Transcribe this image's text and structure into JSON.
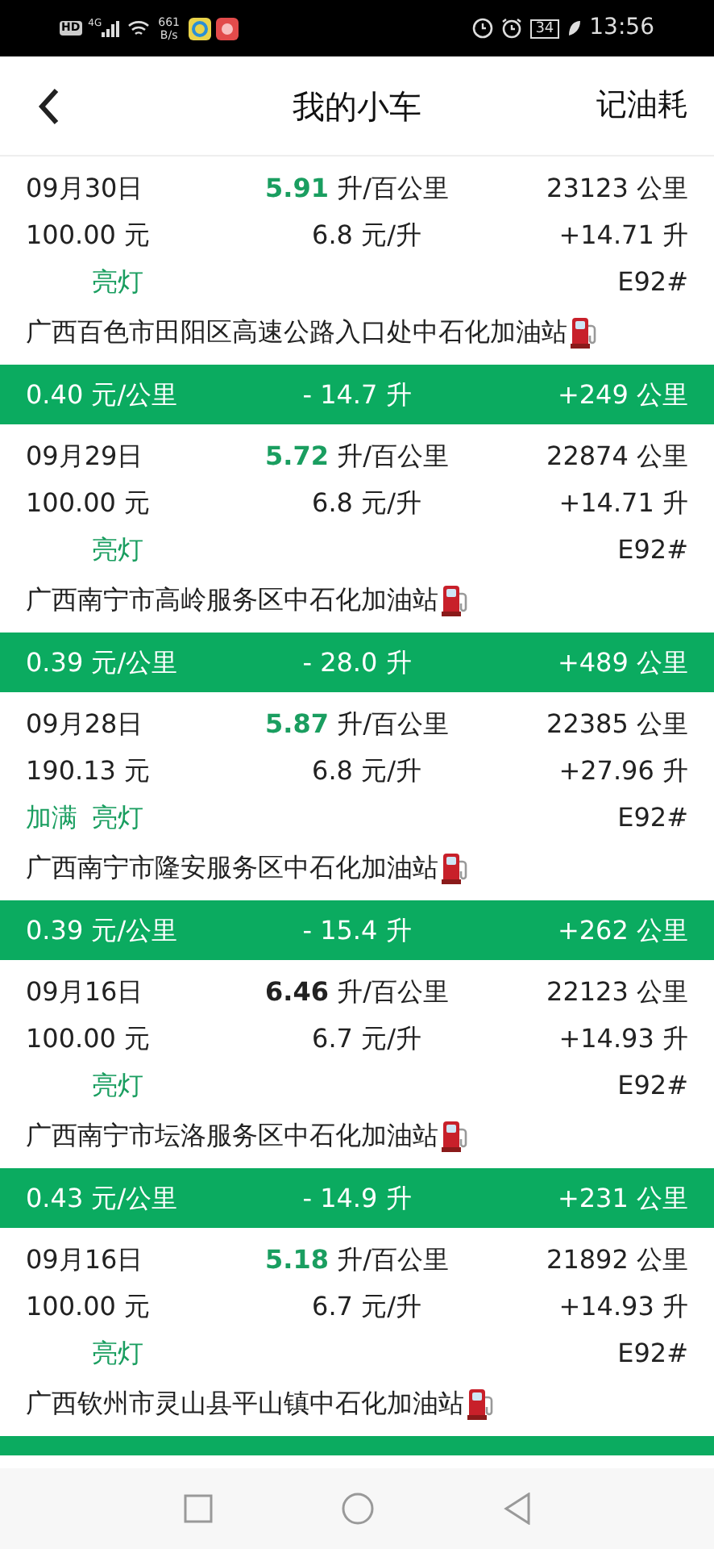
{
  "status_bar": {
    "hd": "HD",
    "network": "4G",
    "speed": "661",
    "speed_unit": "B/s",
    "battery": "34",
    "time": "13:56"
  },
  "header": {
    "title": "我的小车",
    "action": "记油耗"
  },
  "records": [
    {
      "date": "09月30日",
      "efficiency": "5.91",
      "efficiency_unit": "升/百公里",
      "color": "#1a9e60",
      "odometer": "23123 公里",
      "cost": "100.00 元",
      "price": "6.8 元/升",
      "volume": "+14.71 升",
      "light_tag": "亮灯",
      "fuel_type": "E92#",
      "station": "广西百色市田阳区高速公路入口处中石化加油站",
      "summary": {
        "cost_per_km": "0.40 元/公里",
        "used": "- 14.7 升",
        "distance": "+249 公里"
      }
    },
    {
      "date": "09月29日",
      "efficiency": "5.72",
      "efficiency_unit": "升/百公里",
      "color": "#1a9e60",
      "odometer": "22874 公里",
      "cost": "100.00 元",
      "price": "6.8 元/升",
      "volume": "+14.71 升",
      "light_tag": "亮灯",
      "fuel_type": "E92#",
      "station": "广西南宁市高岭服务区中石化加油站",
      "summary": {
        "cost_per_km": "0.39 元/公里",
        "used": "- 28.0 升",
        "distance": "+489 公里"
      }
    },
    {
      "date": "09月28日",
      "efficiency": "5.87",
      "efficiency_unit": "升/百公里",
      "color": "#1a9e60",
      "odometer": "22385 公里",
      "cost": "190.13 元",
      "price": "6.8 元/升",
      "volume": "+27.96 升",
      "full_tag": "加满",
      "light_tag": "亮灯",
      "fuel_type": "E92#",
      "station": "广西南宁市隆安服务区中石化加油站",
      "summary": {
        "cost_per_km": "0.39 元/公里",
        "used": "- 15.4 升",
        "distance": "+262 公里"
      }
    },
    {
      "date": "09月16日",
      "efficiency": "6.46",
      "efficiency_unit": "升/百公里",
      "color": "#222222",
      "odometer": "22123 公里",
      "cost": "100.00 元",
      "price": "6.7 元/升",
      "volume": "+14.93 升",
      "light_tag": "亮灯",
      "fuel_type": "E92#",
      "station": "广西南宁市坛洛服务区中石化加油站",
      "summary": {
        "cost_per_km": "0.43 元/公里",
        "used": "- 14.9 升",
        "distance": "+231 公里"
      }
    },
    {
      "date": "09月16日",
      "efficiency": "5.18",
      "efficiency_unit": "升/百公里",
      "color": "#1a9e60",
      "odometer": "21892 公里",
      "cost": "100.00 元",
      "price": "6.7 元/升",
      "volume": "+14.93 升",
      "light_tag": "亮灯",
      "fuel_type": "E92#",
      "station": "广西钦州市灵山县平山镇中石化加油站"
    }
  ]
}
